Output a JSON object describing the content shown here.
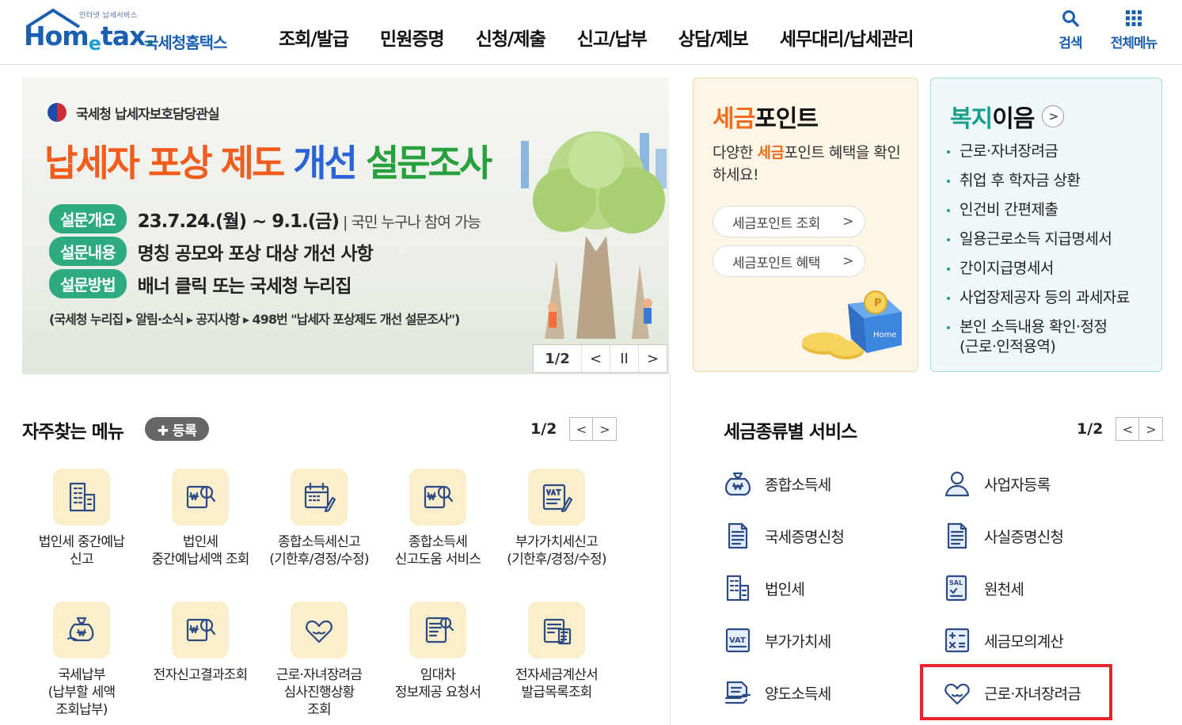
{
  "header": {
    "logo_tagline": "인터넷 납세서비스",
    "logo_name": "Hometax",
    "logo_ko": "국세청홈택스",
    "gnb": [
      "조회/발급",
      "민원증명",
      "신청/제출",
      "신고/납부",
      "상담/제보",
      "세무대리/납세관리"
    ],
    "search_label": "검색",
    "allmenu_label": "전체메뉴"
  },
  "banner": {
    "org": "국세청 납세자보호담당관실",
    "title_part1": "납세자 포상 제도 ",
    "title_part2": "개선 ",
    "title_part3": "설문조사",
    "rows": [
      {
        "pill": "설문개요",
        "text": "23.7.24.(월) ~ 9.1.(금)",
        "sub": " | 국민 누구나 참여 가능"
      },
      {
        "pill": "설문내용",
        "text": "명칭 공모와 포상 대상 개선 사항",
        "sub": ""
      },
      {
        "pill": "설문방법",
        "text": "배너 클릭 또는 국세청 누리집",
        "sub": ""
      }
    ],
    "path": "(국세청 누리집 ▸ 알림·소식 ▸ 공지사항 ▸ 498번 \"납세자 포상제도 개선 설문조사\")",
    "page": "1/2",
    "prev": "<",
    "pause": "II",
    "next": ">"
  },
  "point_box": {
    "title_hl": "세금",
    "title_rest": "포인트",
    "desc_pre": "다양한 ",
    "desc_hl": "세금",
    "desc_post": "포인트 혜택을 확인하세요!",
    "btn1": "세금포인트 조회",
    "btn2": "세금포인트 혜택",
    "chev": ">",
    "art_label": "Home"
  },
  "welfare_box": {
    "title_hl": "복지",
    "title_rest": "이음",
    "arrow": ">",
    "items": [
      "근로·자녀장려금",
      "취업 후 학자금 상환",
      "인건비 간편제출",
      "일용근로소득 지급명세서",
      "간이지급명세서",
      "사업장제공자 등의 과세자료",
      "본인 소득내용 확인·정정\n(근로·인적용역)"
    ]
  },
  "frequent": {
    "title": "자주찾는 메뉴",
    "register": "✚ 등록",
    "page": "1/2",
    "prev": "<",
    "next": ">",
    "items": [
      {
        "label": "법인세 중간예납\n신고",
        "icon": "building-icon"
      },
      {
        "label": "법인세\n중간예납세액 조회",
        "icon": "won-document-search-icon"
      },
      {
        "label": "종합소득세신고\n(기한후/경정/수정)",
        "icon": "calendar-pen-icon"
      },
      {
        "label": "종합소득세\n신고도움 서비스",
        "icon": "won-document-search-icon"
      },
      {
        "label": "부가가치세신고\n(기한후/경정/수정)",
        "icon": "vat-pen-icon"
      },
      {
        "label": "국세납부\n(납부할 세액\n조회납부)",
        "icon": "money-bag-icon"
      },
      {
        "label": "전자신고결과조회",
        "icon": "won-document-search-icon"
      },
      {
        "label": "근로·자녀장려금\n심사진행상황\n조회",
        "icon": "heart-hands-icon"
      },
      {
        "label": "임대차\n정보제공 요청서",
        "icon": "document-search-icon"
      },
      {
        "label": "전자세금계산서\n발급목록조회",
        "icon": "invoice-calculator-icon"
      }
    ]
  },
  "tax_service": {
    "title": "세금종류별 서비스",
    "page": "1/2",
    "prev": "<",
    "next": ">",
    "items": [
      {
        "label": "종합소득세",
        "icon": "money-bag-won-icon"
      },
      {
        "label": "사업자등록",
        "icon": "person-icon"
      },
      {
        "label": "국세증명신청",
        "icon": "document-icon"
      },
      {
        "label": "사실증명신청",
        "icon": "document-icon"
      },
      {
        "label": "법인세",
        "icon": "building-icon"
      },
      {
        "label": "원천세",
        "icon": "salary-document-icon"
      },
      {
        "label": "부가가치세",
        "icon": "vat-icon"
      },
      {
        "label": "세금모의계산",
        "icon": "calculator-icon"
      },
      {
        "label": "양도소득세",
        "icon": "transfer-document-icon"
      },
      {
        "label": "근로·자녀장려금",
        "icon": "heart-hands-icon"
      }
    ]
  },
  "colors": {
    "brand_blue": "#1b5fb0",
    "orange": "#ef6d1c",
    "teal": "#1a9e8c",
    "highlight_red": "#e8242b"
  }
}
